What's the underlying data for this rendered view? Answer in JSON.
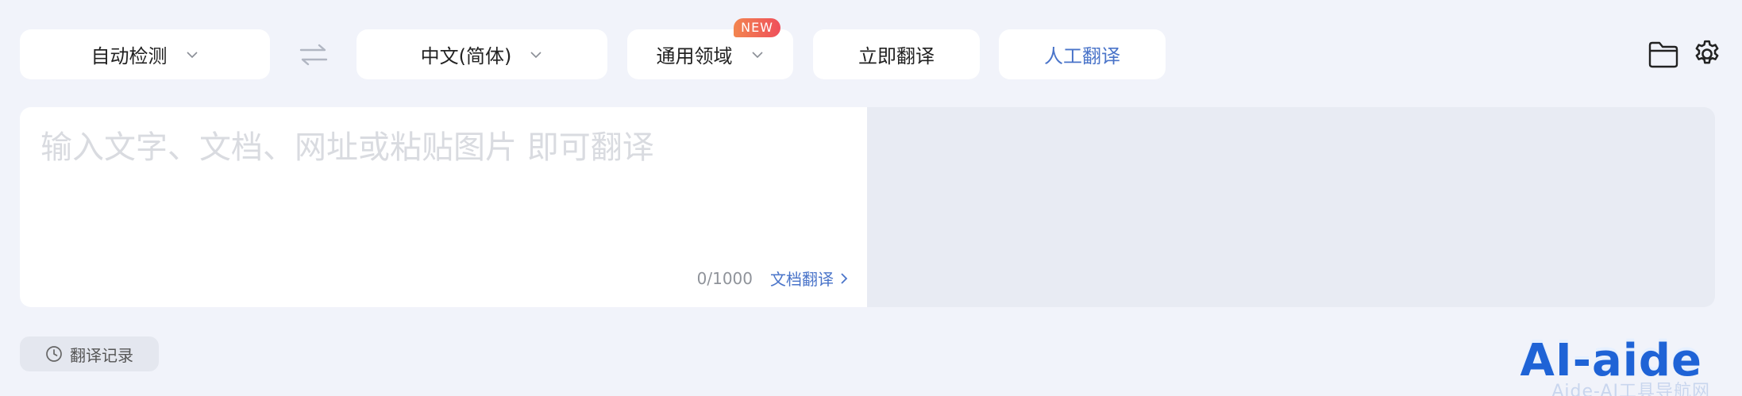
{
  "toolbar": {
    "source_language": "自动检测",
    "target_language": "中文(简体)",
    "domain": "通用领域",
    "domain_badge": "NEW",
    "translate_now": "立即翻译",
    "human_translate": "人工翻译"
  },
  "editor": {
    "placeholder": "输入文字、文档、网址或粘贴图片 即可翻译",
    "char_count": "0/1000",
    "doc_translate": "文档翻译"
  },
  "footer": {
    "history": "翻译记录"
  },
  "watermark": {
    "logo": "AI-aide",
    "subtitle": "Aide-AI工具导航网"
  },
  "colors": {
    "accent": "#4a74c9",
    "background": "#f1f3fa",
    "badge_start": "#f2854f",
    "badge_end": "#ef4f5b"
  },
  "icons": [
    "chevron-down-icon",
    "swap-icon",
    "folder-icon",
    "gear-icon",
    "chevron-right-icon",
    "clock-icon"
  ]
}
